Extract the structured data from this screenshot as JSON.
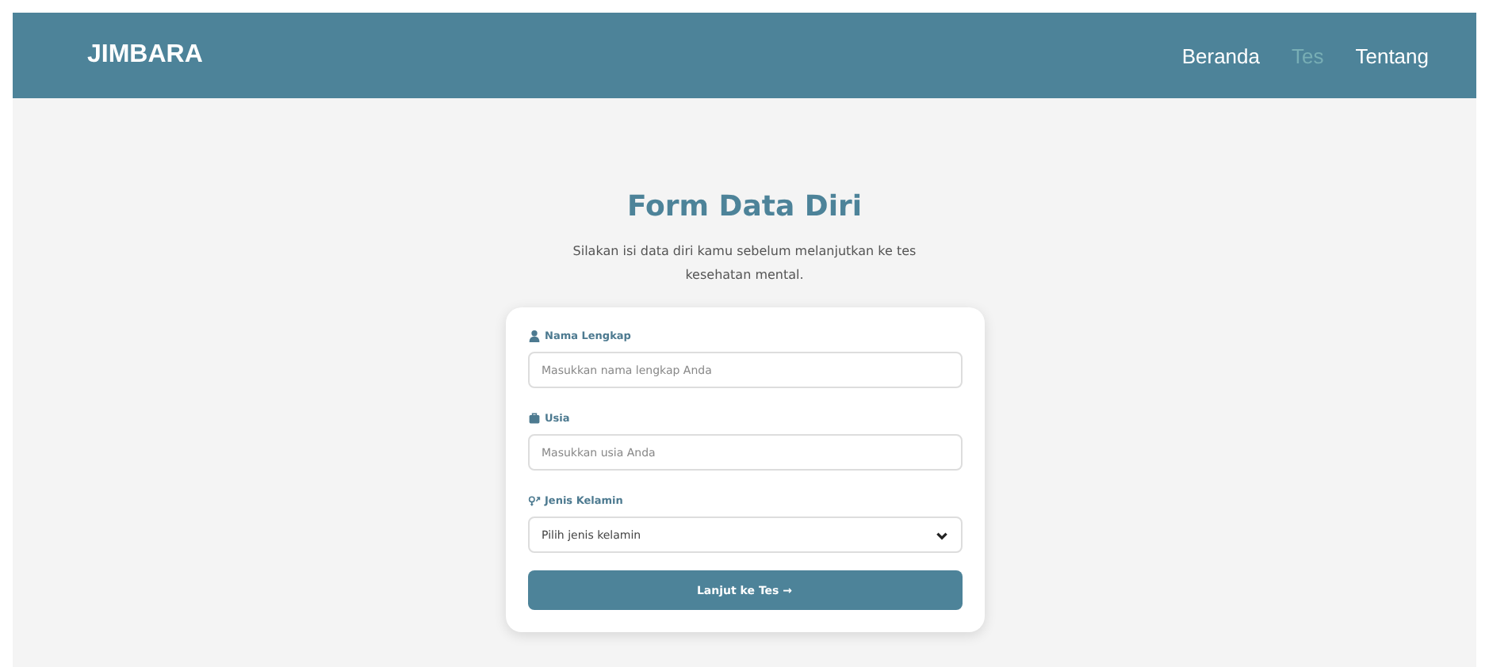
{
  "header": {
    "brand": "JIMBARA",
    "nav": [
      {
        "label": "Beranda",
        "selected": false
      },
      {
        "label": "Tes",
        "selected": true
      },
      {
        "label": "Tentang",
        "selected": false
      }
    ]
  },
  "form": {
    "title": "Form Data Diri",
    "subtitle": "Silakan isi data diri kamu sebelum melanjutkan ke tes kesehatan mental.",
    "fields": [
      {
        "kind": "text",
        "label": "Nama Lengkap",
        "placeholder": "Masukkan nama lengkap Anda"
      },
      {
        "kind": "text",
        "label": "Usia",
        "placeholder": "Masukkan usia Anda"
      },
      {
        "kind": "select",
        "label": "Jenis Kelamin",
        "value": "Pilih jenis kelamin"
      }
    ],
    "submit": "Lanjut ke Tes →"
  }
}
